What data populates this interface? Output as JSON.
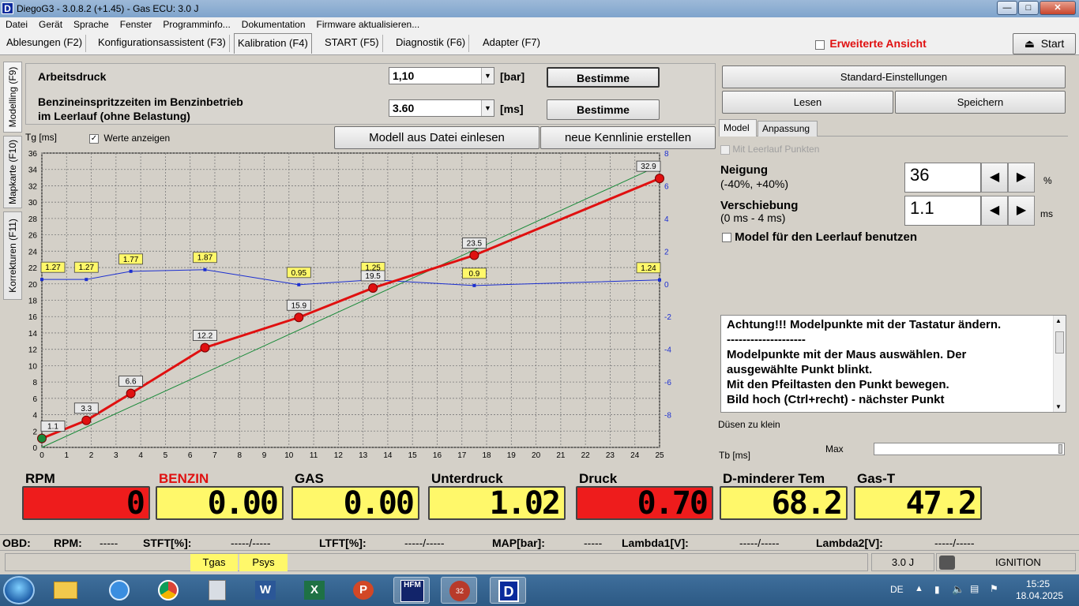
{
  "window": {
    "title": "DiegoG3 - 3.0.8.2 (+1.45) - Gas ECU: 3.0 J",
    "app_icon": "D"
  },
  "menu": [
    "Datei",
    "Gerät",
    "Sprache",
    "Fenster",
    "Programminfo...",
    "Dokumentation",
    "Firmware aktualisieren..."
  ],
  "tabs": [
    "Ablesungen (F2)",
    "Konfigurationsassistent (F3)",
    "Kalibration (F4)",
    "START (F5)",
    "Diagnostik (F6)",
    "Adapter (F7)"
  ],
  "advanced_view": "Erweiterte Ansicht",
  "start_button": "Start",
  "side_tabs": [
    "Modelling (F9)",
    "Mapkarte (F10)",
    "Korrekturen (F11)"
  ],
  "params": {
    "pressure_label": "Arbeitsdruck",
    "pressure_value": "1,10",
    "pressure_unit": "[bar]",
    "inj_label_1": "Benzineinspritzzeiten im Benzinbetrieb",
    "inj_label_2": "im Leerlauf (ohne Belastung)",
    "inj_value": "3.60",
    "inj_unit": "[ms]",
    "determine": "Bestimme"
  },
  "chart_header": {
    "tg_label": "Tg [ms]",
    "show_values": "Werte anzeigen",
    "load_model": "Modell aus Datei einlesen",
    "new_curve": "neue Kennlinie erstellen"
  },
  "chart_data": {
    "type": "line",
    "y_ticks": [
      0,
      2,
      4,
      6,
      8,
      10,
      12,
      14,
      16,
      18,
      20,
      22,
      24,
      26,
      28,
      30,
      32,
      34,
      36
    ],
    "x_ticks": [
      0,
      1,
      2,
      3,
      4,
      5,
      6,
      7,
      8,
      9,
      10,
      11,
      12,
      13,
      14,
      15,
      16,
      17,
      18,
      19,
      20,
      21,
      22,
      23,
      24,
      25
    ],
    "y2_ticks": [
      8,
      6,
      4,
      2,
      0,
      -2,
      -4,
      -6,
      -8
    ],
    "xlim": [
      0,
      25
    ],
    "ylim": [
      0,
      36
    ],
    "y2lim": [
      -10,
      8
    ],
    "series": [
      {
        "x": [
          0,
          1.8,
          3.6,
          6.6,
          10.4,
          13.4,
          17.5,
          25
        ],
        "y": [
          1.1,
          3.3,
          6.6,
          12.2,
          15.9,
          19.5,
          23.5,
          32.9
        ],
        "labels": [
          "1.1",
          "3.3",
          "6.6",
          "12.2",
          "15.9",
          "19.5",
          "23.5",
          "32.9"
        ],
        "color": "#e01010"
      },
      {
        "x": [
          0,
          25
        ],
        "y": [
          0,
          34.5
        ],
        "color": "#1a8a3a"
      },
      {
        "x": [
          0,
          1.8,
          3.6,
          6.6,
          10.4,
          13.4,
          17.5,
          25
        ],
        "y": [
          1.27,
          1.27,
          1.77,
          1.87,
          0.95,
          1.25,
          0.9,
          1.24
        ],
        "labels": [
          "1.27",
          "1.27",
          "1.77",
          "1.87",
          "0.95",
          "1.25",
          "0.9",
          "1.24"
        ],
        "color": "#1c2fd0"
      }
    ]
  },
  "right": {
    "std_settings": "Standard-Einstellungen",
    "read": "Lesen",
    "save": "Speichern",
    "subtabs": [
      "Model",
      "Anpassung"
    ],
    "idle_points": "Mit Leerlauf Punkten",
    "slope_label": "Neigung",
    "slope_range": "(-40%, +40%)",
    "slope_value": "36",
    "slope_unit": "%",
    "shift_label": "Verschiebung",
    "shift_range": "(0 ms - 4 ms)",
    "shift_value": "1.1",
    "shift_unit": "ms",
    "use_idle": "Model für den Leerlauf benutzen",
    "info": [
      "Achtung!!! Modelpunkte mit der Tastatur ändern.",
      "--------------------",
      "Modelpunkte mit der Maus auswählen. Der",
      "ausgewählte Punkt blinkt.",
      "Mit den Pfeiltasten den Punkt bewegen.",
      "Bild hoch (Ctrl+recht) - nächster Punkt"
    ],
    "nozzle": "Düsen zu klein",
    "tb": "Tb [ms]",
    "max": "Max"
  },
  "gauges": [
    {
      "label": "RPM",
      "value": "0",
      "color": "red",
      "label_color": "#000000"
    },
    {
      "label": "BENZIN",
      "value": "0.00",
      "color": "yellow",
      "label_color": "#e01010"
    },
    {
      "label": "GAS",
      "value": "0.00",
      "color": "yellow",
      "label_color": "#000000"
    },
    {
      "label": "Unterdruck",
      "value": "1.02",
      "color": "yellow",
      "label_color": "#000000"
    },
    {
      "label": "Druck",
      "value": "0.70",
      "color": "red",
      "label_color": "#000000"
    },
    {
      "label": "D-minderer Tem",
      "value": "68.2",
      "color": "yellow",
      "label_color": "#000000"
    },
    {
      "label": "Gas-T",
      "value": "47.2",
      "color": "yellow",
      "label_color": "#000000"
    }
  ],
  "obd": {
    "obd": "OBD:",
    "rpm": "RPM:",
    "rpm_v": "-----",
    "stft": "STFT[%]:",
    "stft_v": "-----/-----",
    "ltft": "LTFT[%]:",
    "ltft_v": "-----/-----",
    "map": "MAP[bar]:",
    "map_v": "-----",
    "l1": "Lambda1[V]:",
    "l1_v": "-----/-----",
    "l2": "Lambda2[V]:",
    "l2_v": "-----/-----"
  },
  "status": {
    "tgas": "Tgas",
    "psys": "Psys",
    "ecu": "3.0 J",
    "ignition": "IGNITION"
  },
  "tray": {
    "lang": "DE",
    "time": "15:25",
    "date": "18.04.2025"
  }
}
